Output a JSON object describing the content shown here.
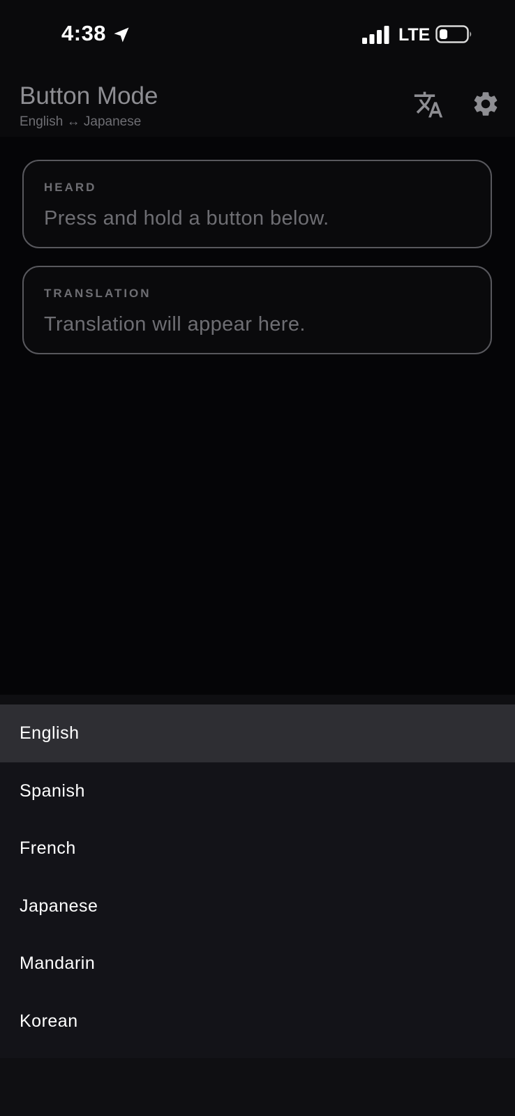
{
  "status_bar": {
    "time": "4:38",
    "network": "LTE",
    "location_icon": "location-arrow-icon",
    "signal_icon": "cellular-signal-icon",
    "battery_icon": "battery-low-icon"
  },
  "header": {
    "title": "Button Mode",
    "subtitle": "English ↔ Japanese",
    "translate_icon": "translate-icon",
    "settings_icon": "gear-icon"
  },
  "heard_card": {
    "label": "HEARD",
    "text": "Press and hold a button below."
  },
  "translation_card": {
    "label": "TRANSLATION",
    "text": "Translation will appear here."
  },
  "language_menu": {
    "selected_index": 0,
    "items": [
      {
        "label": "English"
      },
      {
        "label": "Spanish"
      },
      {
        "label": "French"
      },
      {
        "label": "Japanese"
      },
      {
        "label": "Mandarin"
      },
      {
        "label": "Korean"
      }
    ]
  },
  "colors": {
    "background": "#050507",
    "header_text": "#8e8e93",
    "muted_text": "#6e6e73",
    "card_border": "#58585d",
    "menu_background": "#131318",
    "menu_selected": "#2e2e33"
  }
}
